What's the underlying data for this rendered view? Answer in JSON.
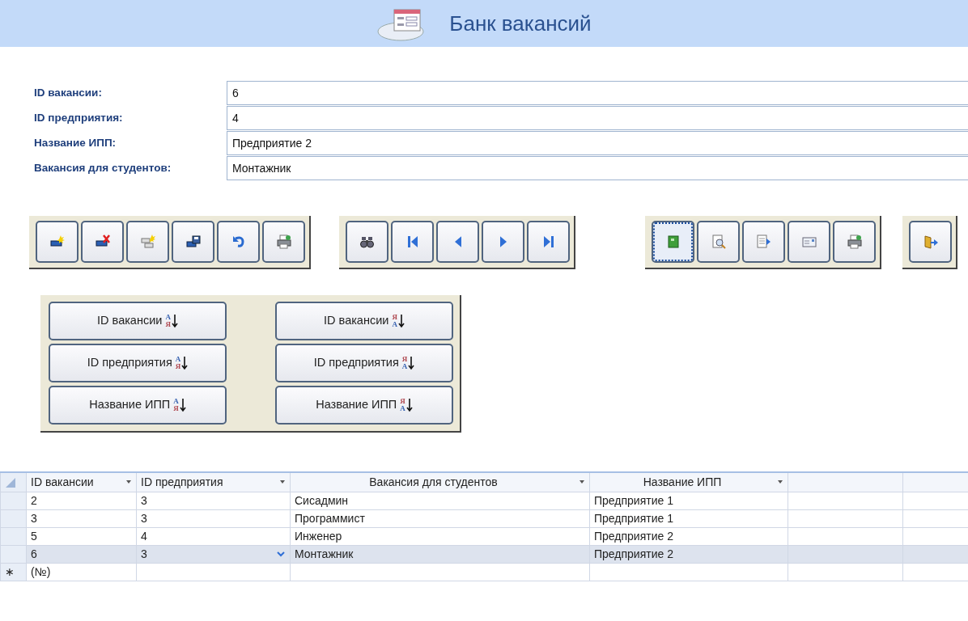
{
  "form_header": {
    "title": "Банк вакансий"
  },
  "fields": [
    {
      "label": "ID вакансии:",
      "value": "6"
    },
    {
      "label": "ID предприятия:",
      "value": "4"
    },
    {
      "label": "Название ИПП:",
      "value": "Предприятие 2"
    },
    {
      "label": "Вакансия для студентов:",
      "value": "Монтажник"
    }
  ],
  "toolbar_groups": [
    {
      "buttons": [
        {
          "focused": false
        },
        {
          "focused": false
        },
        {
          "focused": false
        },
        {
          "focused": false
        },
        {
          "focused": false
        },
        {
          "focused": false
        }
      ]
    },
    {
      "buttons": [
        {
          "focused": false
        },
        {
          "focused": false
        },
        {
          "focused": false
        },
        {
          "focused": false
        },
        {
          "focused": false
        }
      ]
    },
    {
      "buttons": [
        {
          "focused": true
        },
        {
          "focused": false
        },
        {
          "focused": false
        },
        {
          "focused": false
        },
        {
          "focused": false
        }
      ]
    },
    {
      "buttons": [
        {
          "focused": false
        }
      ]
    }
  ],
  "sort_buttons": [
    {
      "label": "ID вакансии",
      "descending": false,
      "icon_letters": [
        "А",
        "Я"
      ]
    },
    {
      "label": "ID вакансии",
      "descending": true,
      "icon_letters": [
        "Я",
        "А"
      ]
    },
    {
      "label": "ID предприятия",
      "descending": false,
      "icon_letters": [
        "А",
        "Я"
      ]
    },
    {
      "label": "ID предприятия",
      "descending": true,
      "icon_letters": [
        "Я",
        "А"
      ]
    },
    {
      "label": "Название ИПП",
      "descending": false,
      "icon_letters": [
        "А",
        "Я"
      ]
    },
    {
      "label": "Название ИПП",
      "descending": true,
      "icon_letters": [
        "Я",
        "А"
      ]
    }
  ],
  "table": {
    "columns": [
      "ID вакансии",
      "ID предприятия",
      "Вакансия для студентов",
      "Название ИПП"
    ],
    "rows": [
      {
        "cells": [
          "2",
          "3",
          "Сисадмин",
          "Предприятие 1"
        ],
        "selected": false
      },
      {
        "cells": [
          "3",
          "3",
          "Программист",
          "Предприятие 1"
        ],
        "selected": false
      },
      {
        "cells": [
          "5",
          "4",
          "Инженер",
          "Предприятие 2"
        ],
        "selected": false
      },
      {
        "cells": [
          "6",
          "3",
          "Монтажник",
          "Предприятие 2"
        ],
        "selected": true
      }
    ],
    "new_row": {
      "marker": "∗",
      "placeholder": "(№)"
    }
  }
}
